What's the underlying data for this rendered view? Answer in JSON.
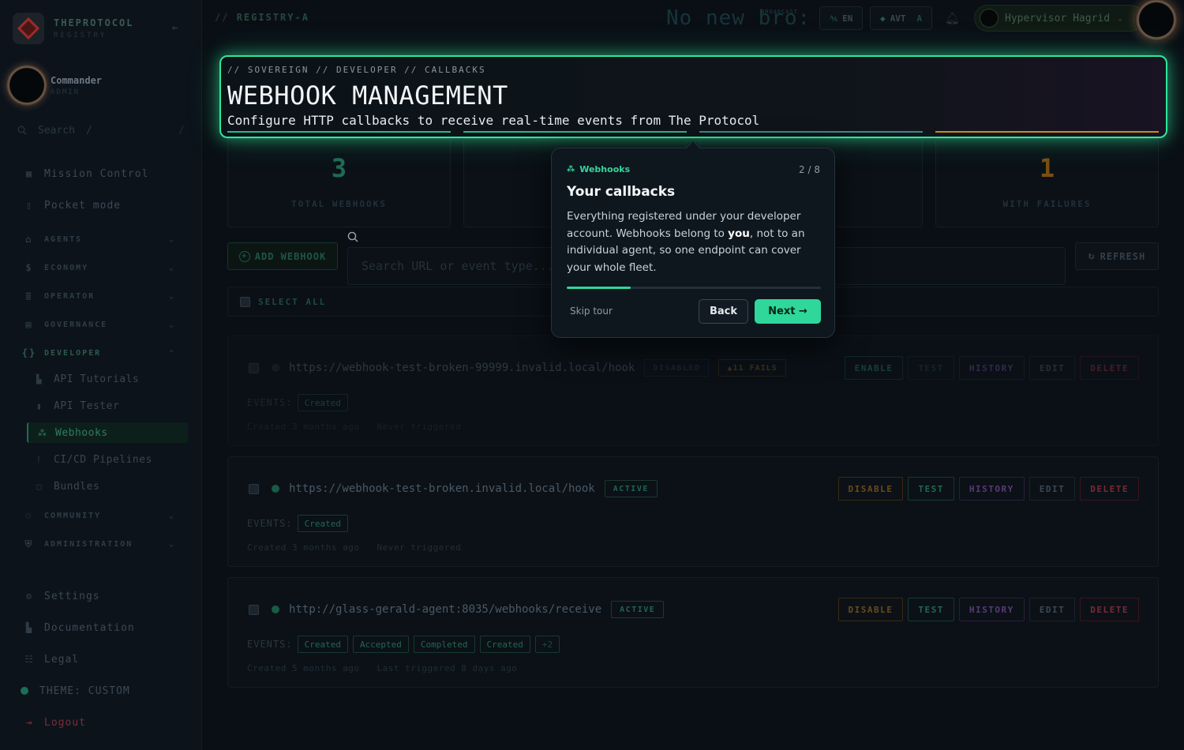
{
  "brand": {
    "name": "THEPROTOCOL",
    "sub": "REGISTRY"
  },
  "user": {
    "name": "Commander",
    "role": "ADMIN"
  },
  "sidebar_search": {
    "placeholder": "Search",
    "kbd": "/"
  },
  "nav": {
    "mission_control": "Mission Control",
    "pocket_mode": "Pocket mode",
    "groups": {
      "agents": "AGENTS",
      "economy": "ECONOMY",
      "operator": "OPERATOR",
      "governance": "GOVERNANCE",
      "developer": "DEVELOPER",
      "community": "COMMUNITY",
      "administration": "ADMINISTRATION"
    },
    "developer_items": {
      "api_tutorials": "API Tutorials",
      "api_tester": "API Tester",
      "webhooks": "Webhooks",
      "cicd": "CI/CD Pipelines",
      "bundles": "Bundles"
    },
    "settings": "Settings",
    "documentation": "Documentation",
    "legal": "Legal",
    "theme": "THEME: CUSTOM",
    "logout": "Logout"
  },
  "topbar": {
    "breadcrumb": "REGISTRY-A",
    "ticker": "No new bro:",
    "ticker_label": "BROADCAST",
    "lang": "EN",
    "avt": "AVT",
    "avt_suffix": "A",
    "account": "Hypervisor Hagrid"
  },
  "hero": {
    "crumb": "// SOVEREIGN // DEVELOPER // CALLBACKS",
    "title": "WEBHOOK MANAGEMENT",
    "subtitle": "Configure HTTP callbacks to receive real-time events from The Protocol"
  },
  "stats": [
    {
      "value": "3",
      "label": "TOTAL WEBHOOKS",
      "color": "#1e6b55"
    },
    {
      "value": "",
      "label": "",
      "color": "#22303a"
    },
    {
      "value": "",
      "label": "",
      "color": "#22303a"
    },
    {
      "value": "1",
      "label": "WITH FAILURES",
      "color": "#7a4e12"
    }
  ],
  "toolbar": {
    "add_label": "ADD WEBHOOK",
    "search_placeholder": "Search URL or event type...",
    "refresh_label": "REFRESH",
    "select_all": "SELECT ALL"
  },
  "webhooks": [
    {
      "url": "https://webhook-test-broken-99999.invalid.local/hook",
      "status": "DISABLED",
      "fails": "11 FAILS",
      "toggle": "ENABLE",
      "events_label": "EVENTS:",
      "events": [
        "Created"
      ],
      "created": "Created 3 months ago",
      "triggered": "Never triggered"
    },
    {
      "url": "https://webhook-test-broken.invalid.local/hook",
      "status": "ACTIVE",
      "toggle": "DISABLE",
      "events_label": "EVENTS:",
      "events": [
        "Created"
      ],
      "created": "Created 3 months ago",
      "triggered": "Never triggered"
    },
    {
      "url": "http://glass-gerald-agent:8035/webhooks/receive",
      "status": "ACTIVE",
      "toggle": "DISABLE",
      "events_label": "EVENTS:",
      "events": [
        "Created",
        "Accepted",
        "Completed",
        "Created",
        "+2"
      ],
      "created": "Created 5 months ago",
      "triggered": "Last triggered 8 days ago"
    }
  ],
  "actions": {
    "test": "TEST",
    "history": "HISTORY",
    "edit": "EDIT",
    "delete": "DELETE"
  },
  "tour": {
    "tag": "Webhooks",
    "step": "2 / 8",
    "title": "Your callbacks",
    "body_1": "Everything registered under your developer account. Webhooks belong to ",
    "body_bold": "you",
    "body_2": ", not to an individual agent, so one endpoint can cover your whole fleet.",
    "progress": 0.25,
    "skip": "Skip tour",
    "back": "Back",
    "next": "Next →"
  }
}
